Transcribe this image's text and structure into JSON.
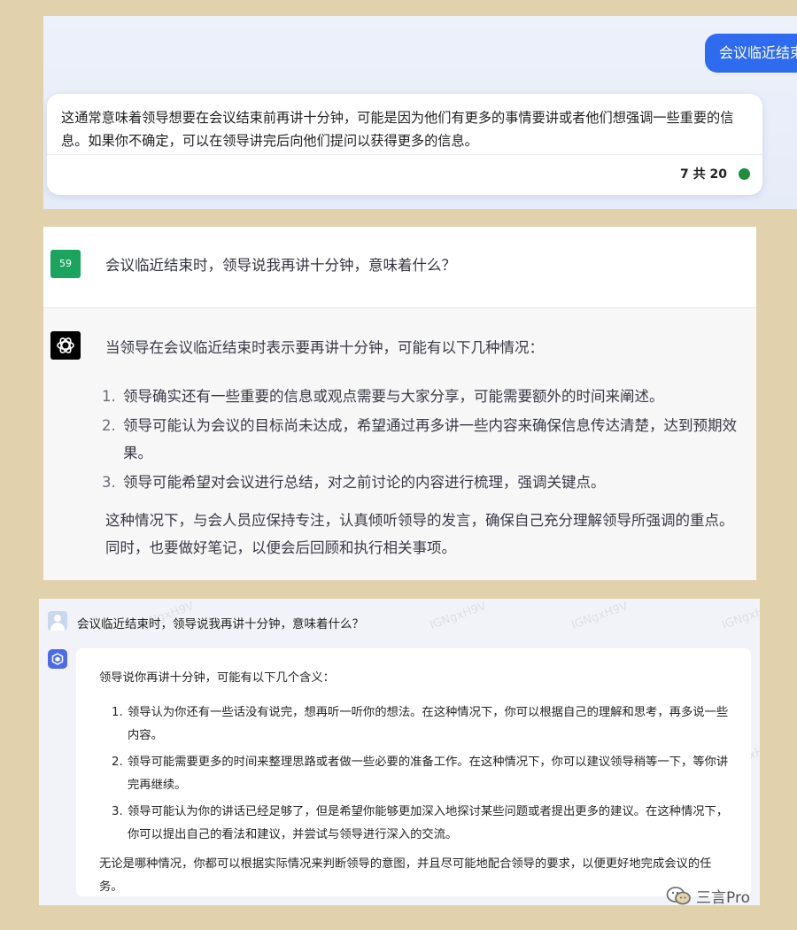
{
  "panel1": {
    "user_message": "会议临近结束",
    "answer": "这通常意味着领导想要在会议结束前再讲十分钟，可能是因为他们有更多的事情要讲或者他们想强调一些重要的信息。如果你不确定，可以在领导讲完后向他们提问以获得更多的信息。",
    "counter": "7 共 20",
    "status_color": "#1e8e3e"
  },
  "panel2": {
    "user_avatar_text": "59",
    "question": "会议临近结束时，领导说我再讲十分钟，意味着什么？",
    "intro": "当领导在会议临近结束时表示要再讲十分钟，可能有以下几种情况：",
    "items": [
      {
        "num": "1.",
        "text": "领导确实还有一些重要的信息或观点需要与大家分享，可能需要额外的时间来阐述。"
      },
      {
        "num": "2.",
        "text": "领导可能认为会议的目标尚未达成，希望通过再多讲一些内容来确保信息传达清楚，达到预期效果。"
      },
      {
        "num": "3.",
        "text": "领导可能希望对会议进行总结，对之前讨论的内容进行梳理，强调关键点。"
      }
    ],
    "conclusion": "这种情况下，与会人员应保持专注，认真倾听领导的发言，确保自己充分理解领导所强调的重点。同时，也要做好笔记，以便会后回顾和执行相关事项。"
  },
  "panel3": {
    "question": "会议临近结束时，领导说我再讲十分钟，意味着什么？",
    "intro": "领导说你再讲十分钟，可能有以下几个含义：",
    "items": [
      {
        "num": "1.",
        "text": "领导认为你还有一些话没有说完，想再听一听你的想法。在这种情况下，你可以根据自己的理解和思考，再多说一些内容。"
      },
      {
        "num": "2.",
        "text": "领导可能需要更多的时间来整理思路或者做一些必要的准备工作。在这种情况下，你可以建议领导稍等一下，等你讲完再继续。"
      },
      {
        "num": "3.",
        "text": "领导可能认为你的讲话已经足够了，但是希望你能够更加深入地探讨某些问题或者提出更多的建议。在这种情况下，你可以提出自己的看法和建议，并尝试与领导进行深入的交流。"
      }
    ],
    "conclusion": "无论是哪种情况，你都可以根据实际情况来判断领导的意图，并且尽可能地配合领导的要求，以便更好地完成会议的任务。",
    "watermark": "IGNgxH9V"
  },
  "footer": {
    "brand": "三言Pro",
    "icon": "wechat-icon"
  }
}
